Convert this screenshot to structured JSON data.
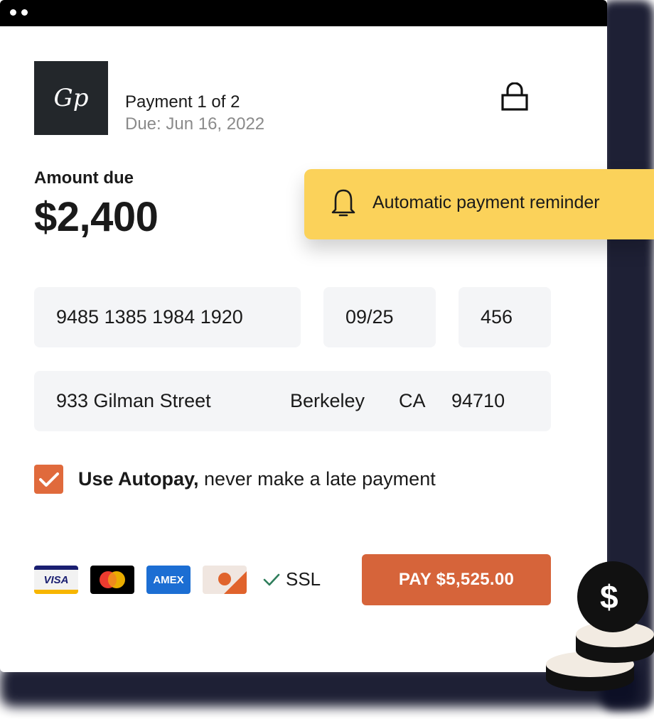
{
  "payment": {
    "title": "Payment 1 of 2",
    "due": "Due: Jun 16, 2022",
    "logo_text": "Gp"
  },
  "amount": {
    "label": "Amount due",
    "value": "$2,400"
  },
  "notification": {
    "text": "Automatic payment reminder",
    "icon": "bell-icon",
    "color": "#fbd25a"
  },
  "card": {
    "number": "9485 1385 1984 1920",
    "expiry": "09/25",
    "cvv": "456"
  },
  "address": {
    "street": "933 Gilman Street",
    "city": "Berkeley",
    "state": "CA",
    "zip": "94710"
  },
  "autopay": {
    "checked": true,
    "bold_label": "Use Autopay,",
    "label": " never make a late payment"
  },
  "payment_methods": {
    "visa": "VISA",
    "amex": "AMEX",
    "ssl": "SSL"
  },
  "pay_button": {
    "label": "PAY $5,525.00",
    "color": "#d6643a"
  },
  "decoration": {
    "coin_symbol": "$"
  }
}
